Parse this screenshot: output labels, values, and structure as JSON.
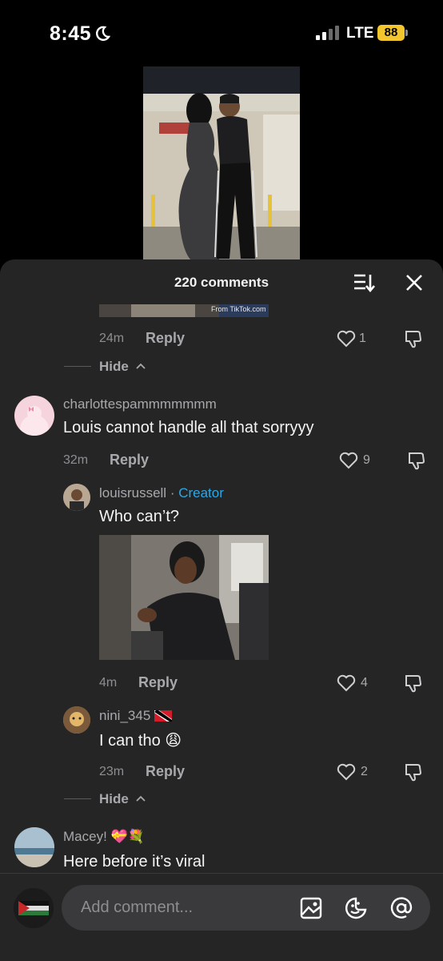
{
  "status_bar": {
    "time": "8:45",
    "network": "LTE",
    "battery": "88"
  },
  "sheet": {
    "comment_count": "220 comments"
  },
  "thread_top": {
    "time": "24m",
    "reply": "Reply",
    "likes": "1",
    "hide": "Hide"
  },
  "comments": [
    {
      "username": "charlottespammmmmmm",
      "text": "Louis cannot handle all that sorryyy",
      "time": "32m",
      "reply": "Reply",
      "likes": "9"
    },
    {
      "username": "louisrussell",
      "creator_sep": " · ",
      "creator_label": "Creator",
      "text": "Who can’t?",
      "time": "4m",
      "reply": "Reply",
      "likes": "4"
    },
    {
      "username": "nini_345",
      "text": "I can tho",
      "emoji": "😩",
      "time": "23m",
      "reply": "Reply",
      "likes": "2",
      "hide": "Hide"
    },
    {
      "username": "Macey!",
      "emoji": "💝💐",
      "text": "Here before it’s viral"
    }
  ],
  "gif_watermark": "From TikTok.com",
  "input": {
    "placeholder": "Add comment..."
  },
  "icons": [
    "moon-icon",
    "signal-icon",
    "sort-icon",
    "close-icon",
    "heart-icon",
    "dislike-icon",
    "chevron-up-icon",
    "image-icon",
    "emoji-icon",
    "at-icon",
    "flag-icon"
  ]
}
